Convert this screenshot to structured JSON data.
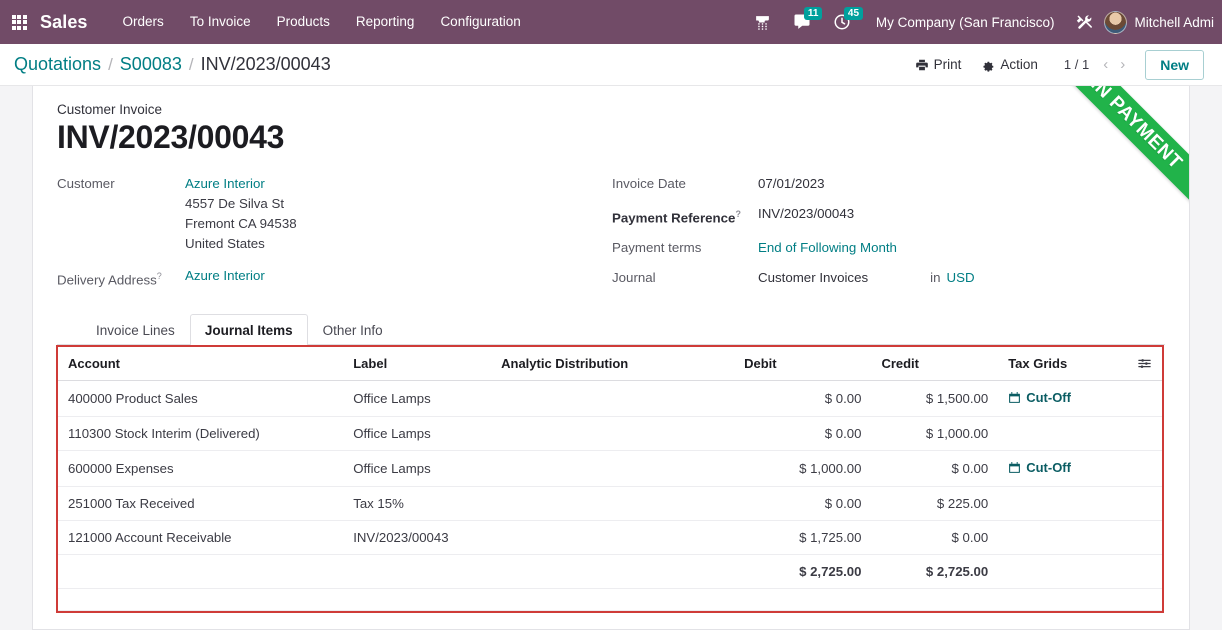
{
  "navbar": {
    "apps_icon": "apps-grid-icon",
    "brand": "Sales",
    "menus": [
      {
        "label": "Orders"
      },
      {
        "label": "To Invoice"
      },
      {
        "label": "Products"
      },
      {
        "label": "Reporting"
      },
      {
        "label": "Configuration"
      }
    ],
    "sys": {
      "dialpad_icon": "phone-dialpad-icon",
      "messages_icon": "chat-bubble-icon",
      "messages_count": "11",
      "activities_icon": "clock-icon",
      "activities_count": "45",
      "company": "My Company (San Francisco)",
      "debug_icon": "tools-wrench-icon",
      "avatar_icon": "user-avatar",
      "username": "Mitchell Admi"
    },
    "colors": {
      "background": "#714B67",
      "badge": "#00A09D"
    }
  },
  "control_panel": {
    "breadcrumb": [
      {
        "label": "Quotations",
        "current": false
      },
      {
        "label": "S00083",
        "current": false
      },
      {
        "label": "INV/2023/00043",
        "current": true
      }
    ],
    "separator": "/",
    "print": {
      "label": "Print",
      "icon": "printer-icon"
    },
    "action": {
      "label": "Action",
      "icon": "gear-icon"
    },
    "pager": "1 / 1",
    "prev_icon": "chevron-left-icon",
    "next_icon": "chevron-right-icon",
    "new_label": "New"
  },
  "record": {
    "ribbon": "IN PAYMENT",
    "ribbon_color": "#21B34A",
    "subtitle": "Customer Invoice",
    "title": "INV/2023/00043",
    "left_fields": {
      "customer_label": "Customer",
      "customer_value": "Azure Interior",
      "address": [
        "4557 De Silva St",
        "Fremont CA 94538",
        "United States"
      ],
      "delivery_label": "Delivery Address",
      "delivery_help": "?",
      "delivery_value": "Azure Interior"
    },
    "right_fields": {
      "invoice_date_label": "Invoice Date",
      "invoice_date_value": "07/01/2023",
      "payment_reference_label": "Payment Reference",
      "payment_reference_help": "?",
      "payment_reference_value": "INV/2023/00043",
      "payment_terms_label": "Payment terms",
      "payment_terms_value": "End of Following Month",
      "journal_label": "Journal",
      "journal_value": "Customer Invoices",
      "currency_prefix": "in",
      "currency_value": "USD"
    }
  },
  "notebook": {
    "tabs": [
      {
        "label": "Invoice Lines",
        "active": false
      },
      {
        "label": "Journal Items",
        "active": true
      },
      {
        "label": "Other Info",
        "active": false
      }
    ]
  },
  "journal_items": {
    "columns": [
      "Account",
      "Label",
      "Analytic Distribution",
      "Debit",
      "Credit",
      "Tax Grids"
    ],
    "optional_columns_icon": "sliders-adjust-icon",
    "rows": [
      {
        "account": "400000 Product Sales",
        "label": "Office Lamps",
        "analytic": "",
        "debit": "$ 0.00",
        "credit": "$ 1,500.00",
        "tax_grids": "Cut-Off",
        "tax_grids_icon": "calendar-icon"
      },
      {
        "account": "110300 Stock Interim (Delivered)",
        "label": "Office Lamps",
        "analytic": "",
        "debit": "$ 0.00",
        "credit": "$ 1,000.00",
        "tax_grids": "",
        "tax_grids_icon": ""
      },
      {
        "account": "600000 Expenses",
        "label": "Office Lamps",
        "analytic": "",
        "debit": "$ 1,000.00",
        "credit": "$ 0.00",
        "tax_grids": "Cut-Off",
        "tax_grids_icon": "calendar-icon"
      },
      {
        "account": "251000 Tax Received",
        "label": "Tax 15%",
        "analytic": "",
        "debit": "$ 0.00",
        "credit": "$ 225.00",
        "tax_grids": "",
        "tax_grids_icon": ""
      },
      {
        "account": "121000 Account Receivable",
        "label": "INV/2023/00043",
        "analytic": "",
        "debit": "$ 1,725.00",
        "credit": "$ 0.00",
        "tax_grids": "",
        "tax_grids_icon": ""
      }
    ],
    "totals": {
      "debit": "$ 2,725.00",
      "credit": "$ 2,725.00"
    },
    "highlight_color": "#cf3b38"
  }
}
